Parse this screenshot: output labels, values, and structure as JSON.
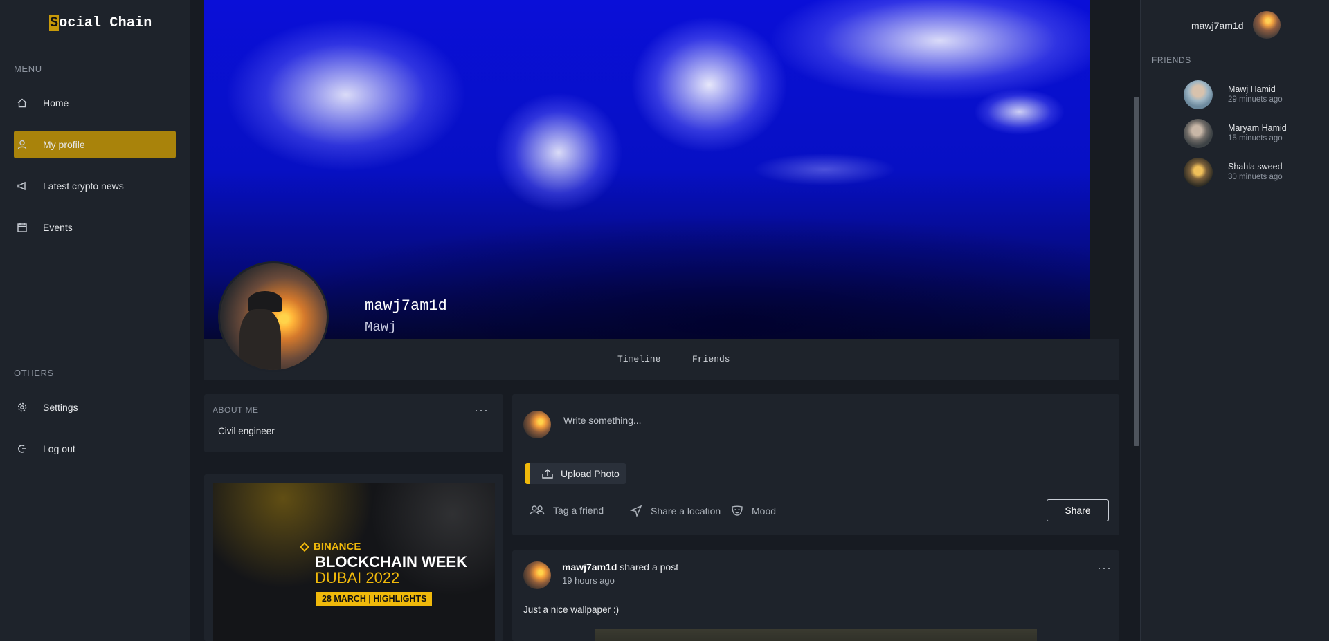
{
  "app": {
    "brand_first": "S",
    "brand_rest": "ocial Chain"
  },
  "sidebar": {
    "menu_label": "MENU",
    "items": [
      {
        "label": "Home",
        "icon": "home-icon"
      },
      {
        "label": "My profile",
        "icon": "user-icon",
        "active": true
      },
      {
        "label": "Latest crypto news",
        "icon": "megaphone-icon"
      },
      {
        "label": "Events",
        "icon": "calendar-icon"
      }
    ],
    "others_label": "OTHERS",
    "others": [
      {
        "label": "Settings",
        "icon": "gear-icon"
      },
      {
        "label": "Log out",
        "icon": "logout-icon"
      }
    ]
  },
  "profile": {
    "username": "mawj7am1d",
    "display_name": "Mawj"
  },
  "tabs": [
    "Timeline",
    "Friends"
  ],
  "about": {
    "title": "ABOUT ME",
    "text": "Civil engineer"
  },
  "ad": {
    "brand": "BINANCE",
    "title": "BLOCKCHAIN WEEK",
    "subtitle": "DUBAI 2022",
    "badge": "28 MARCH  |  HIGHLIGHTS"
  },
  "composer": {
    "placeholder": "Write something...",
    "upload_label": "Upload Photo",
    "actions": [
      "Tag a friend",
      "Share a location",
      "Mood"
    ],
    "share_label": "Share"
  },
  "post": {
    "user": "mawj7am1d",
    "action": "shared a post",
    "time": "19 hours ago",
    "text": "Just a nice wallpaper :)"
  },
  "right": {
    "username": "mawj7am1d",
    "friends_label": "FRIENDS",
    "friends": [
      {
        "name": "Mawj Hamid",
        "time": "29 minuets ago"
      },
      {
        "name": "Maryam Hamid",
        "time": "15 minuets ago"
      },
      {
        "name": "Shahla sweed",
        "time": "30 minuets ago"
      }
    ]
  },
  "colors": {
    "accent": "#a9830b",
    "binance_yellow": "#f0b90b",
    "bg": "#1b2029"
  }
}
